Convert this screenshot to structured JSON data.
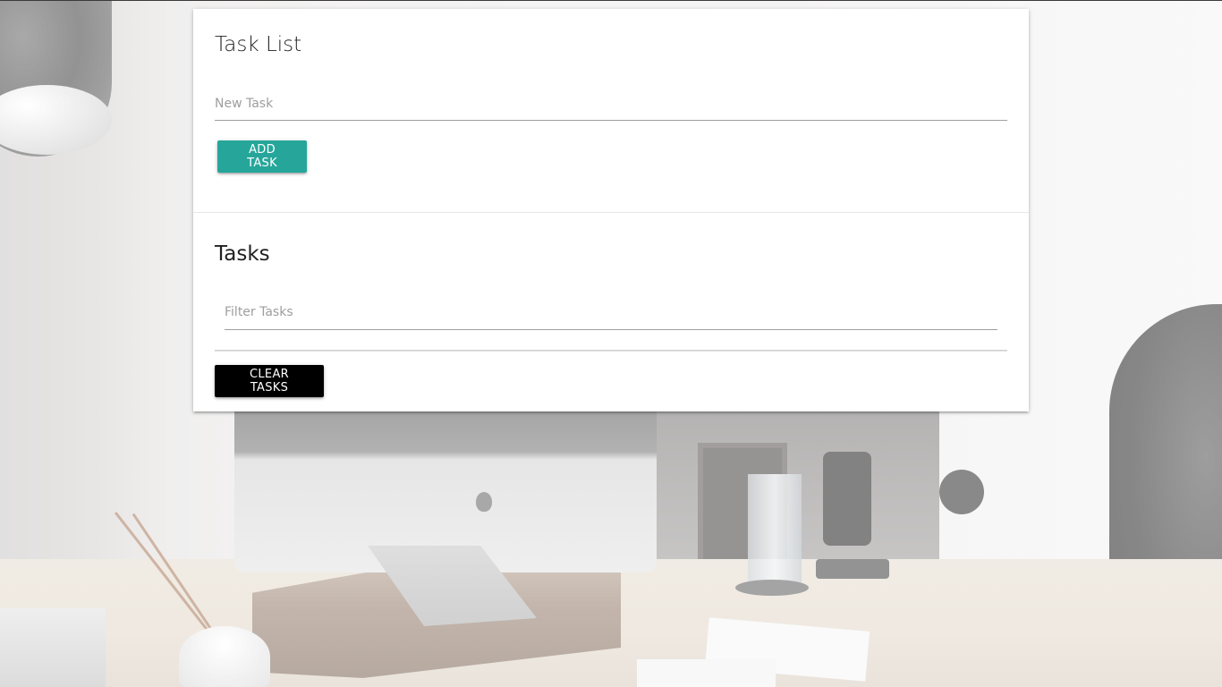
{
  "task_form": {
    "title": "Task List",
    "new_task_placeholder": "New Task",
    "new_task_value": "",
    "add_button_label": "Add Task"
  },
  "tasks_section": {
    "title": "Tasks",
    "filter_placeholder": "Filter Tasks",
    "filter_value": "",
    "items": [],
    "clear_button_label": "Clear Tasks"
  },
  "colors": {
    "add_button": "#26a69a",
    "clear_button": "#000000"
  }
}
